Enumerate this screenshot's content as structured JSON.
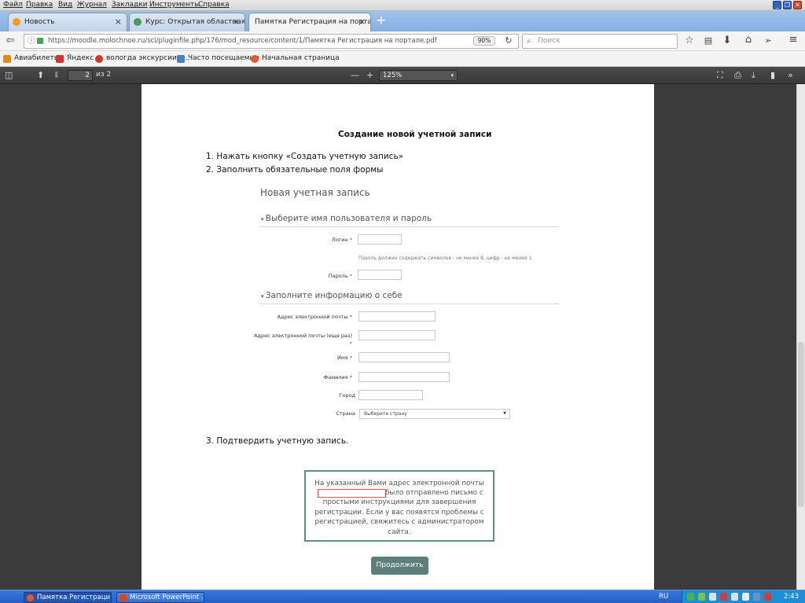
{
  "menubar": {
    "items": [
      "Файл",
      "Правка",
      "Вид",
      "Журнал",
      "Закладки",
      "Инструменты",
      "Справка"
    ]
  },
  "tabs": [
    {
      "label": "Новость",
      "icon": "moodle-icon",
      "active": false
    },
    {
      "label": "Курс: Открытая областная ...",
      "icon": "course-icon",
      "active": false
    },
    {
      "label": "Памятка Регистрация на портале...",
      "icon": "pdf-icon",
      "active": true
    }
  ],
  "newtab": {
    "label": "+"
  },
  "navbar": {
    "url": "https://moodle.molochnoe.ru/sci/pluginfile.php/176/mod_resource/content/1/Памятка Регистрация на портале.pdf",
    "zoom": "90%",
    "search_placeholder": "Поиск"
  },
  "bookmarks": [
    {
      "label": "Авиабилеты",
      "icon": "plane-icon",
      "color": "#e08a1a"
    },
    {
      "label": "Яндекс",
      "icon": "yandex-icon",
      "color": "#d6332b"
    },
    {
      "label": "вологда экскурсии в...",
      "icon": "yandex-y-icon",
      "color": "#d6332b"
    },
    {
      "label": "Часто посещаемые",
      "icon": "folder-icon",
      "color": "#4a7fc1"
    },
    {
      "label": "Начальная страница",
      "icon": "firefox-icon",
      "color": "#e2572b"
    }
  ],
  "pdftoolbar": {
    "page_current": "2",
    "page_total": "из 2",
    "zoom_minus": "—",
    "zoom_plus": "+",
    "zoom_value": "125%"
  },
  "doc": {
    "heading": "Создание новой учетной записи",
    "step1": "1.   Нажать кнопку «Создать учетную запись»",
    "step2": "2.   Заполнить обязательные поля формы",
    "step3": "3.   Подтвердить учетную запись.",
    "form_title": "Новая учетная запись",
    "section1": "Выберите имя пользователя и пароль",
    "section2": "Заполните информацию о себе",
    "login_label": "Логин",
    "password_hint": "Пароль должен содержать символов - не менее 8, цифр - не менее 1",
    "password_label": "Пароль",
    "email_label": "Адрес электронной почты",
    "email2_label": "Адрес электронной почты (еще раз)",
    "firstname_label": "Имя",
    "lastname_label": "Фамилия",
    "city_label": "Город",
    "country_label": "Страна",
    "country_value": "Выберите страну",
    "required_mark": "*",
    "notice_line1": "На указанный Вами адрес электронной почты",
    "notice_line2": "было отправлено письмо с",
    "notice_rest": "простыми инструкциями для завершения регистрации. Если у вас появятся проблемы с регистрацией, свяжитесь с администратором сайта.",
    "continue_label": "Продолжить"
  },
  "taskbar": {
    "items": [
      {
        "label": "Памятка Регистраци...",
        "icon": "firefox-icon",
        "active": true
      },
      {
        "label": "Microsoft PowerPoint ...",
        "icon": "powerpoint-icon",
        "active": false
      }
    ],
    "lang": "RU",
    "clock": "2:43"
  },
  "colors": {
    "teal": "#5c7f7a",
    "required": "#c0392b"
  }
}
